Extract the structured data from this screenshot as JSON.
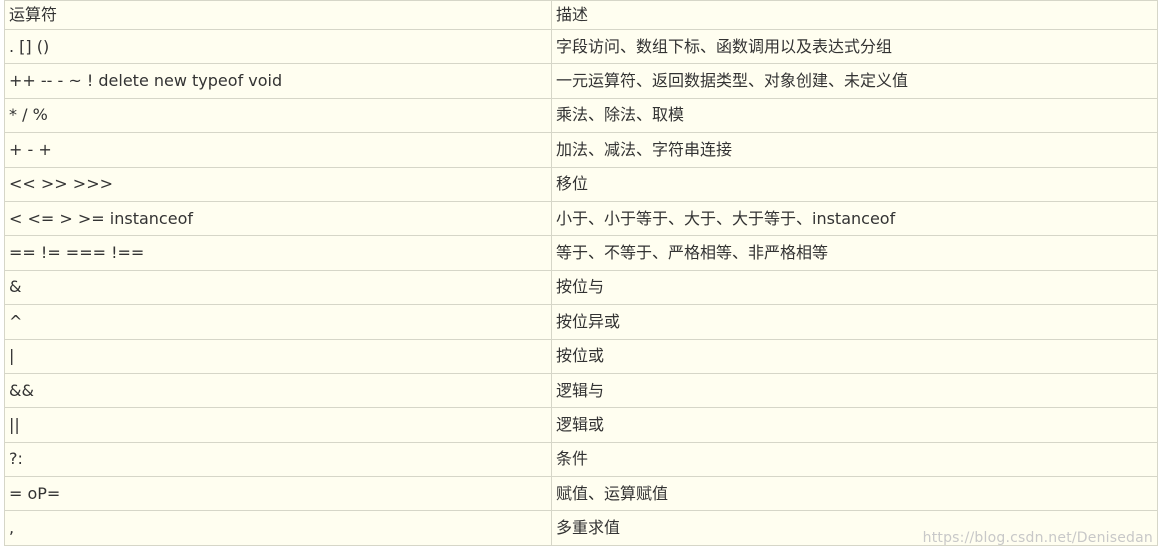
{
  "header": {
    "operator": "运算符",
    "description": "描述"
  },
  "rows": [
    {
      "operator": ". [] ()",
      "description": "字段访问、数组下标、函数调用以及表达式分组"
    },
    {
      "operator": "++ -- - ~ ! delete new typeof void",
      "description": "一元运算符、返回数据类型、对象创建、未定义值"
    },
    {
      "operator": "* / %",
      "description": "乘法、除法、取模"
    },
    {
      "operator": "+ - +",
      "description": "加法、减法、字符串连接"
    },
    {
      "operator": "<< >> >>>",
      "description": "移位"
    },
    {
      "operator": "< <= > >= instanceof",
      "description": "小于、小于等于、大于、大于等于、instanceof"
    },
    {
      "operator": "== != === !==",
      "description": "等于、不等于、严格相等、非严格相等"
    },
    {
      "operator": "&",
      "description": "按位与"
    },
    {
      "operator": "^",
      "description": "按位异或"
    },
    {
      "operator": "|",
      "description": "按位或"
    },
    {
      "operator": "&&",
      "description": "逻辑与"
    },
    {
      "operator": "||",
      "description": "逻辑或"
    },
    {
      "operator": "?:",
      "description": "条件"
    },
    {
      "operator": "= oP=",
      "description": "赋值、运算赋值"
    },
    {
      "operator": ",",
      "description": "多重求值"
    }
  ],
  "watermark": "https://blog.csdn.net/Denisedan"
}
